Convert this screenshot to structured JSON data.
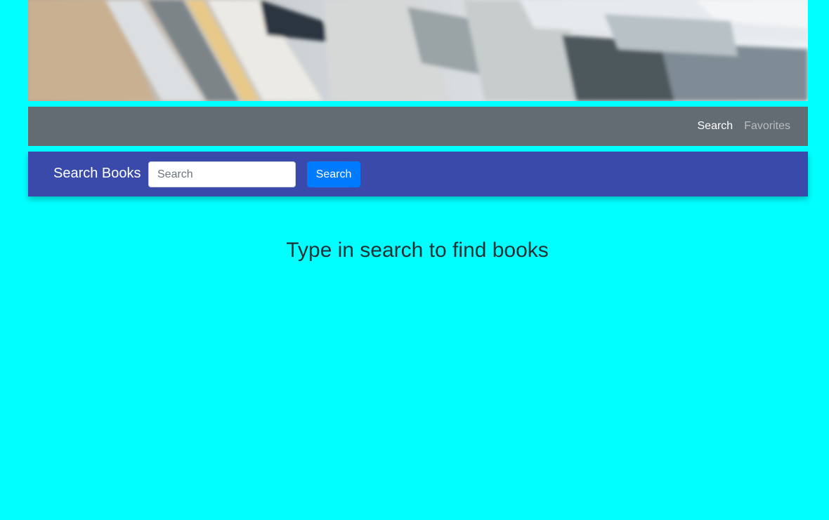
{
  "banner": {
    "image_name": "books-stack-banner"
  },
  "navbar": {
    "links": [
      {
        "label": "Search",
        "state": "active"
      },
      {
        "label": "Favorites",
        "state": "inactive"
      }
    ]
  },
  "searchbar": {
    "brand": "Search Books",
    "input": {
      "placeholder": "Search",
      "value": ""
    },
    "button_label": "Search"
  },
  "main": {
    "message": "Type in search to find books"
  },
  "colors": {
    "page_background": "#00ffff",
    "navbar": "#636c72",
    "searchbar": "#3a4aaa",
    "button": "#007bff"
  }
}
